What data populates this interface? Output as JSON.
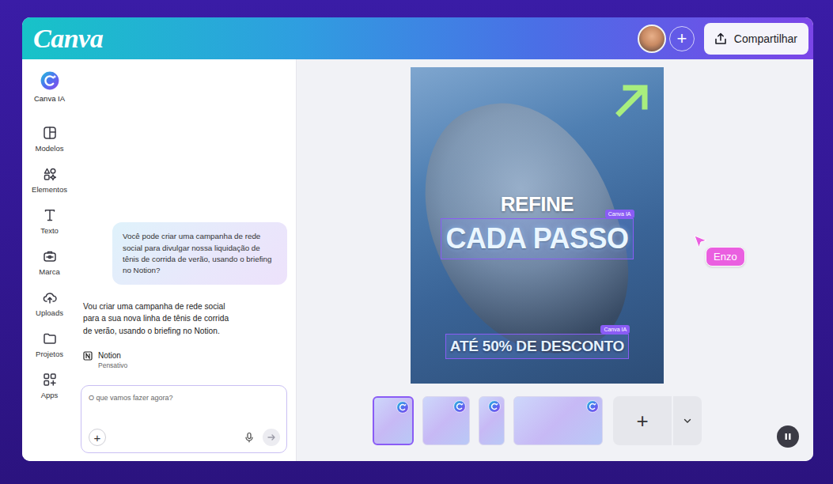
{
  "header": {
    "logo": "Canva",
    "add_label": "+",
    "share_button": "Compartilhar"
  },
  "rail": [
    {
      "label": "Canva IA",
      "selected": true
    },
    {
      "label": "Modelos",
      "selected": false
    },
    {
      "label": "Elementos",
      "selected": false
    },
    {
      "label": "Texto",
      "selected": false
    },
    {
      "label": "Marca",
      "selected": false
    },
    {
      "label": "Uploads",
      "selected": false
    },
    {
      "label": "Projetos",
      "selected": false
    },
    {
      "label": "Apps",
      "selected": false
    }
  ],
  "chat": {
    "messages": [
      {
        "role": "user",
        "text": "Você pode criar uma campanha de rede social para divulgar nossa liquidação de tênis de corrida de verão, usando o briefing no Notion?"
      },
      {
        "role": "assistant",
        "text": "Vou criar uma campanha de rede social para a sua nova linha de tênis de corrida de verão, usando o briefing no Notion."
      }
    ],
    "tool": {
      "name": "Notion",
      "status": "Pensativo"
    },
    "input": {
      "placeholder": "O que vamos fazer agora?",
      "add_label": "+"
    }
  },
  "design": {
    "texts": [
      {
        "kind": "kicker",
        "text": "REFINE",
        "selected": false
      },
      {
        "kind": "title",
        "text": "CADA PASSO",
        "selected": true,
        "badge": "Canva IA"
      },
      {
        "kind": "offer",
        "text": "ATÉ 50% DE DESCONTO",
        "selected": true,
        "badge": "Canva IA"
      }
    ]
  },
  "pages": [
    {
      "kind": "portrait",
      "selected": true
    },
    {
      "kind": "square",
      "selected": false
    },
    {
      "kind": "story",
      "selected": false
    },
    {
      "kind": "landscape",
      "selected": false
    }
  ],
  "add_page": "+",
  "collaborator": {
    "name": "Enzo"
  }
}
